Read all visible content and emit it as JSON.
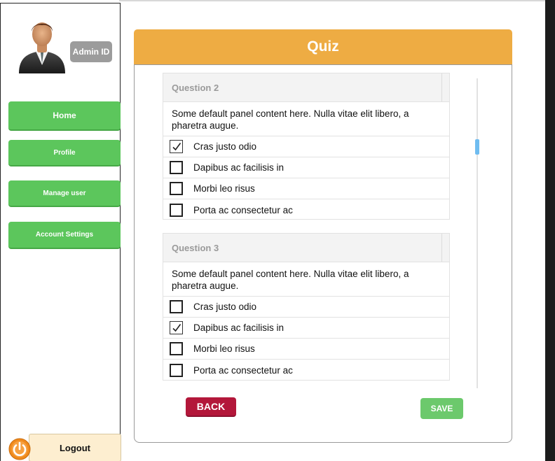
{
  "sidebar": {
    "admin_badge": "Admin ID",
    "nav": [
      {
        "label": "Home"
      },
      {
        "label": "Profile"
      },
      {
        "label": "Manage user"
      },
      {
        "label": "Account Settings"
      }
    ],
    "logout_label": "Logout"
  },
  "quiz": {
    "title": "Quiz",
    "questions": [
      {
        "title": "Question 2",
        "body": "Some default panel content here. Nulla vitae elit libero, a pharetra augue.",
        "options": [
          {
            "label": "Cras justo odio",
            "checked": true
          },
          {
            "label": "Dapibus ac facilisis in",
            "checked": false
          },
          {
            "label": "Morbi leo risus",
            "checked": false
          },
          {
            "label": "Porta ac consectetur ac",
            "checked": false
          }
        ]
      },
      {
        "title": "Question 3",
        "body": "Some default panel content here. Nulla vitae elit libero, a pharetra augue.",
        "options": [
          {
            "label": "Cras justo odio",
            "checked": false
          },
          {
            "label": "Dapibus ac facilisis in",
            "checked": true
          },
          {
            "label": "Morbi leo risus",
            "checked": false
          },
          {
            "label": "Porta ac consectetur ac",
            "checked": false
          }
        ]
      }
    ],
    "back_label": "BACK",
    "save_label": "SAVE"
  },
  "colors": {
    "header": "#eeac43",
    "nav_green": "#5cc65c",
    "back_red": "#b3173a",
    "save_green": "#6cc96c",
    "logout_bg": "#fdeed0",
    "power_orange": "#f08a1c",
    "scroll_thumb": "#6fbcf0"
  },
  "icons": [
    "user-avatar-icon",
    "power-icon",
    "checkbox-icon"
  ]
}
